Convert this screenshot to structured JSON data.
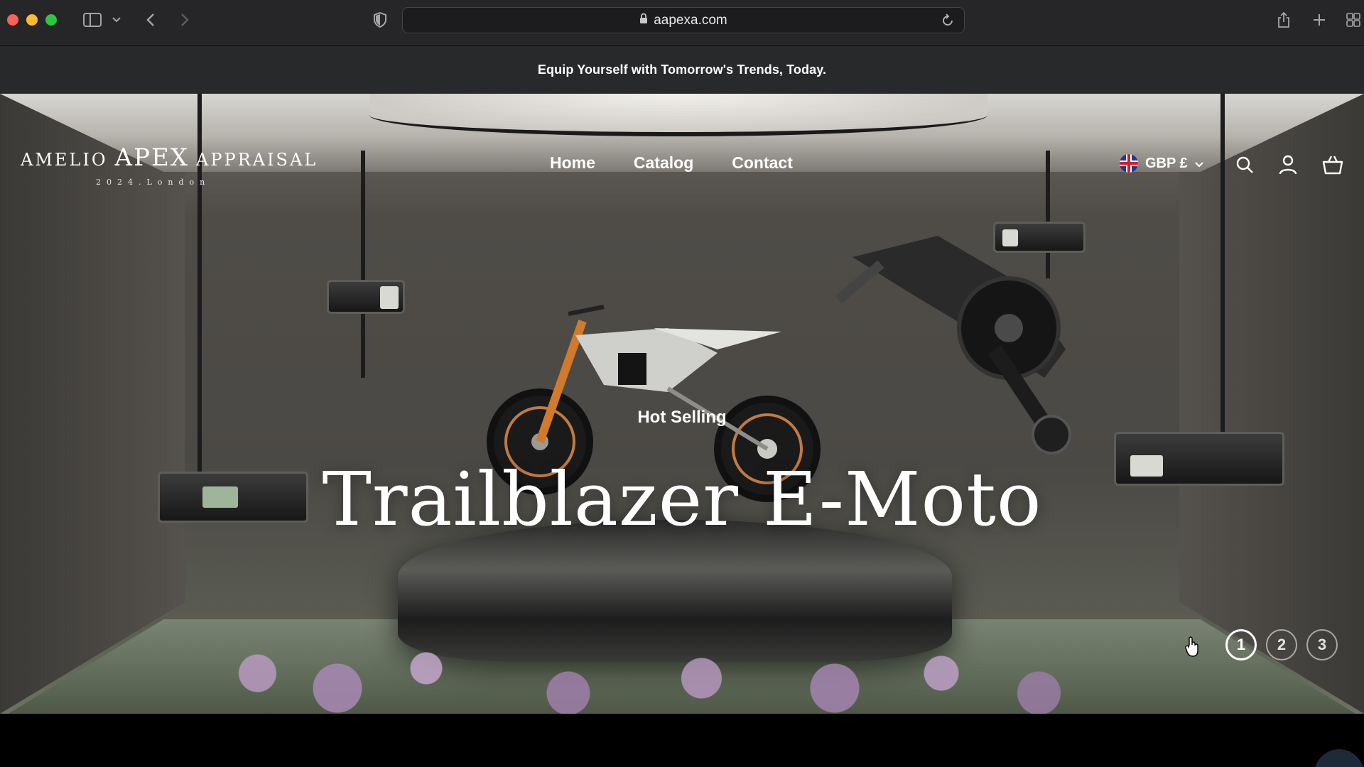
{
  "browser": {
    "url": "aapexa.com"
  },
  "announcement": {
    "text": "Equip Yourself with Tomorrow's Trends, Today."
  },
  "brand": {
    "name_left": "AMELIO",
    "name_mid": "APEX",
    "name_right": "APPRAISAL",
    "tagline": "2024.London"
  },
  "nav": {
    "items": [
      {
        "label": "Home"
      },
      {
        "label": "Catalog"
      },
      {
        "label": "Contact"
      }
    ]
  },
  "header": {
    "currency": "GBP £",
    "icons": [
      "uk-flag-icon",
      "search-icon",
      "account-icon",
      "cart-icon"
    ]
  },
  "hero": {
    "kicker": "Hot Selling",
    "title": "Trailblazer E-Moto",
    "slides": [
      "1",
      "2",
      "3"
    ],
    "active_slide": 1
  },
  "colors": {
    "chrome_bg": "#262628",
    "announcement_bg": "#28292b",
    "text": "#ffffff"
  }
}
